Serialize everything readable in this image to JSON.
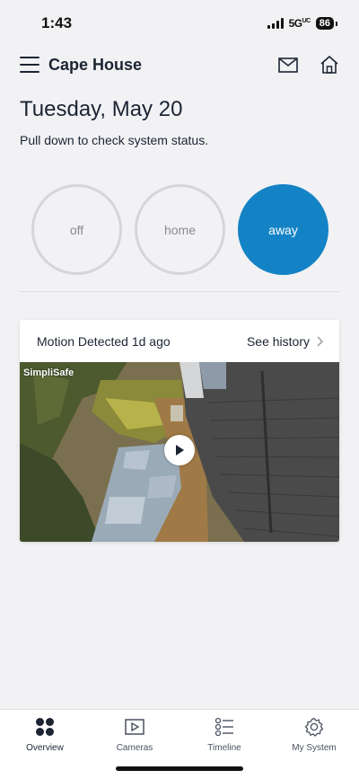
{
  "status_bar": {
    "time": "1:43",
    "network": "5G",
    "network_sup": "UC",
    "battery": "86"
  },
  "header": {
    "title": "Cape House",
    "icons": [
      "menu-icon",
      "mail-icon",
      "home-icon"
    ]
  },
  "date": "Tuesday, May 20",
  "pull_hint": "Pull down to check system status.",
  "modes": [
    {
      "label": "off",
      "active": false
    },
    {
      "label": "home",
      "active": false
    },
    {
      "label": "away",
      "active": true
    }
  ],
  "accent_color": "#1483c5",
  "motion_card": {
    "title": "Motion Detected 1d ago",
    "history_label": "See history",
    "watermark": "SimpliSafe"
  },
  "tabs": [
    {
      "label": "Overview",
      "icon": "grid-icon",
      "active": true
    },
    {
      "label": "Cameras",
      "icon": "camera-play-icon",
      "active": false
    },
    {
      "label": "Timeline",
      "icon": "timeline-icon",
      "active": false
    },
    {
      "label": "My System",
      "icon": "gear-icon",
      "active": false
    }
  ]
}
